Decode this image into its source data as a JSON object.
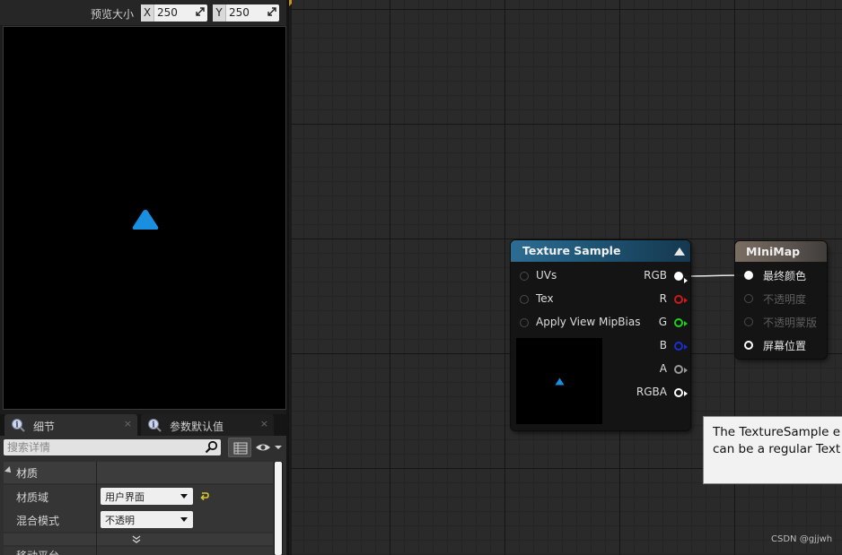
{
  "preview": {
    "size_label": "预览大小",
    "x_label": "X",
    "x_value": "250",
    "y_label": "Y",
    "y_value": "250",
    "shape_color": "#1a8fe0"
  },
  "tabs": [
    {
      "label": "细节",
      "close": "×"
    },
    {
      "label": "参数默认值",
      "close": "×"
    }
  ],
  "details": {
    "search_placeholder": "搜索详情",
    "section_title": "材质",
    "rows": [
      {
        "label": "材质域",
        "value": "用户界面"
      },
      {
        "label": "混合模式",
        "value": "不透明"
      }
    ],
    "cut_row_label": "移动平台"
  },
  "node_texture_sample": {
    "title": "Texture Sample",
    "header_color": "#2d6d93",
    "inputs": [
      "UVs",
      "Tex",
      "Apply View MipBias"
    ],
    "outputs": [
      {
        "label": "RGB",
        "color": "#ffffff"
      },
      {
        "label": "R",
        "color": "#d01818"
      },
      {
        "label": "G",
        "color": "#1ed01e"
      },
      {
        "label": "B",
        "color": "#1a2ed8"
      },
      {
        "label": "A",
        "color": "#9a9a9a"
      },
      {
        "label": "RGBA",
        "color": "#ffffff"
      }
    ]
  },
  "node_minimap": {
    "title": "MIniMap",
    "header_color": "#7a6e62",
    "inputs": [
      {
        "label": "最终颜色",
        "enabled": true
      },
      {
        "label": "不透明度",
        "enabled": false
      },
      {
        "label": "不透明蒙版",
        "enabled": false
      },
      {
        "label": "屏幕位置",
        "enabled": true
      }
    ]
  },
  "tooltip": {
    "line1": "The TextureSample e",
    "line2": "can be a regular Text"
  },
  "watermark": "CSDN @gjjwh"
}
